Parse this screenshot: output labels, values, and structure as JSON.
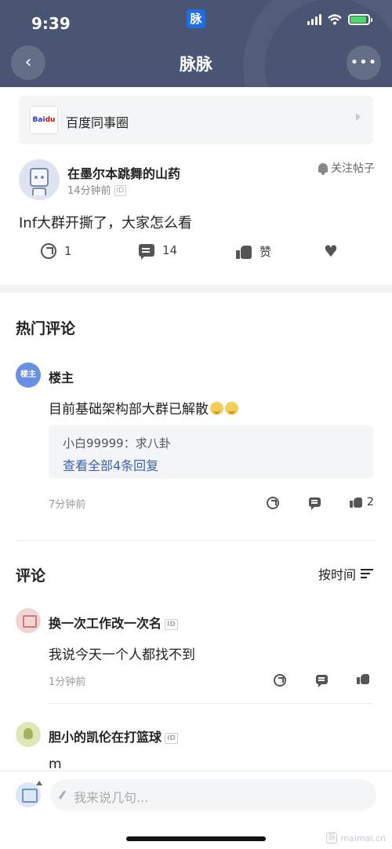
{
  "status_bar": {
    "time": "9:39",
    "app_icon_text": "脉"
  },
  "header": {
    "title": "脉脉",
    "back_icon": "‹",
    "more_icon": "•••"
  },
  "circle": {
    "logo_text": "Bai",
    "logo_accent": "du",
    "name": "百度同事圈"
  },
  "post": {
    "author": "在墨尔本跳舞的山药",
    "time": "14分钟前",
    "id_badge": "ID",
    "follow_label": "关注帖子",
    "text": "Inf大群开撕了，大家怎么看",
    "share_count": "1",
    "comment_count": "14",
    "like_label": "赞"
  },
  "hot_comments": {
    "title": "热门评论",
    "items": [
      {
        "avatar_text": "楼主",
        "author": "楼主",
        "text": "目前基础架构部大群已解散",
        "reply_preview": "小白99999：求八卦",
        "reply_more": "查看全部4条回复",
        "time": "7分钟前",
        "like_count": "2"
      }
    ]
  },
  "comments": {
    "title": "评论",
    "sort_label": "按时间",
    "items": [
      {
        "author": "换一次工作改一次名",
        "id_badge": "ID",
        "text": "我说今天一个人都找不到",
        "time": "1分钟前"
      },
      {
        "author": "胆小的凯伦在打篮球",
        "id_badge": "ID",
        "text": "m"
      }
    ]
  },
  "composer": {
    "placeholder": "我来说几句..."
  },
  "watermark": {
    "logo": "脉",
    "text": "maimai.cn"
  },
  "colors": {
    "header_bg": "#4a5573",
    "link": "#3e5fae",
    "owner_badge": "#6a8fe5"
  }
}
